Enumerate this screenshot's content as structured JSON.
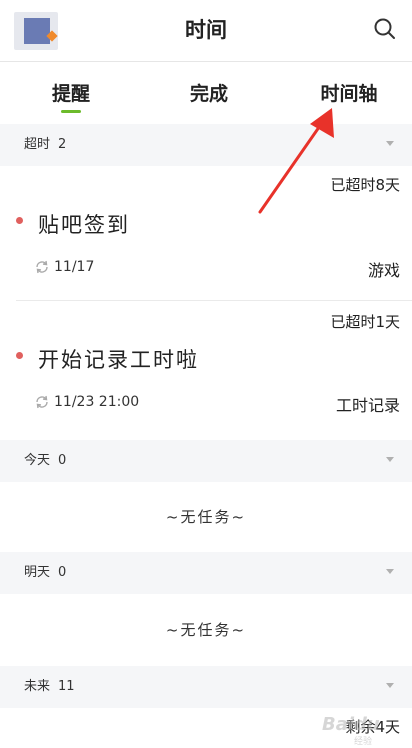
{
  "header": {
    "title": "时间",
    "avatar_icon": "avatar-image",
    "search_icon": "search-icon"
  },
  "tabs": [
    {
      "label": "提醒",
      "active": true
    },
    {
      "label": "完成",
      "active": false
    },
    {
      "label": "时间轴",
      "active": false
    }
  ],
  "accent_color": "#6cbb2b",
  "dot_color": "#e0605e",
  "sections": [
    {
      "label": "超时",
      "count": "2"
    },
    {
      "label": "今天",
      "count": "0"
    },
    {
      "label": "明天",
      "count": "0"
    },
    {
      "label": "未来",
      "count": "11"
    }
  ],
  "overdue_tasks": [
    {
      "status": "已超时8天",
      "title": "贴吧签到",
      "date": "11/17",
      "tag": "游戏"
    },
    {
      "status": "已超时1天",
      "title": "开始记录工时啦",
      "date": "11/23 21:00",
      "tag": "工时记录"
    }
  ],
  "empty_today": "~无任务~",
  "empty_tomorrow": "~无任务~",
  "future_first_status": "剩余4天",
  "watermark": {
    "text": "Baidu",
    "sub": "经验"
  }
}
